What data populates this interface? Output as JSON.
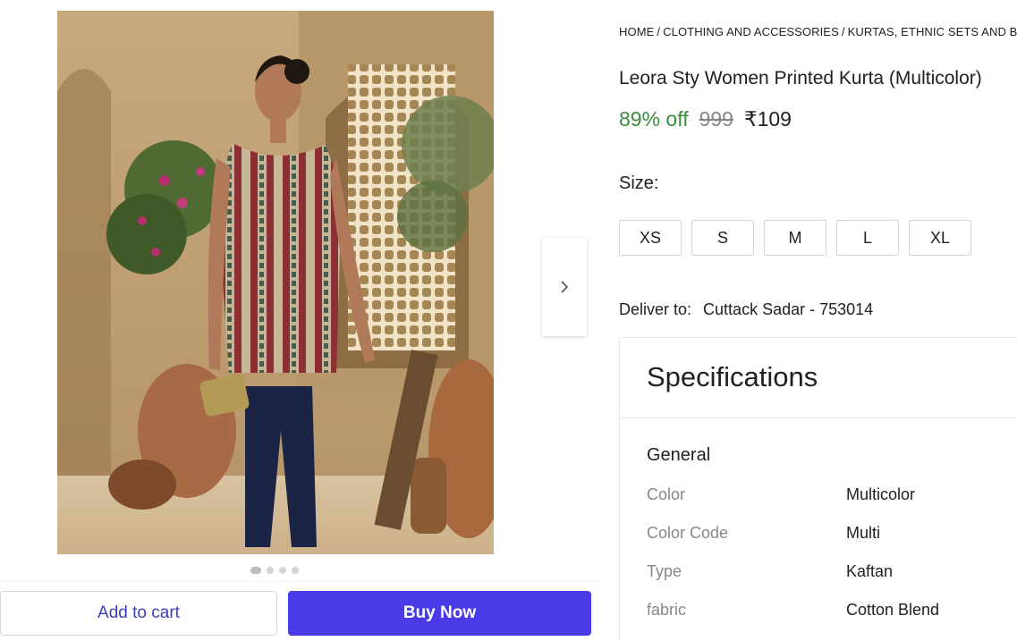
{
  "product_image": {
    "alt": "",
    "carousel": {
      "total": 4,
      "active": 1
    }
  },
  "breadcrumb": [
    "HOME",
    "CLOTHING AND ACCESSORIES",
    "KURTAS, ETHNIC SETS AND BOTT"
  ],
  "product": {
    "title": "Leora Sty Women Printed Kurta (Multicolor)",
    "discount": "89% off",
    "mrp": "999",
    "price": "₹109"
  },
  "size": {
    "label": "Size:",
    "options": [
      "XS",
      "S",
      "M",
      "L",
      "XL"
    ]
  },
  "delivery": {
    "label": "Deliver to:",
    "location": "Cuttack Sadar - 753014"
  },
  "specifications": {
    "title": "Specifications",
    "group": "General",
    "rows": [
      {
        "key": "Color",
        "value": "Multicolor"
      },
      {
        "key": "Color Code",
        "value": "Multi"
      },
      {
        "key": "Type",
        "value": "Kaftan"
      },
      {
        "key": "fabric",
        "value": "Cotton Blend"
      }
    ]
  },
  "actions": {
    "add_to_cart": "Add to cart",
    "buy_now": "Buy Now"
  },
  "colors": {
    "discount_green": "#388e3c",
    "buy_button": "#4a3be8",
    "cart_text": "#3d3dbb"
  }
}
